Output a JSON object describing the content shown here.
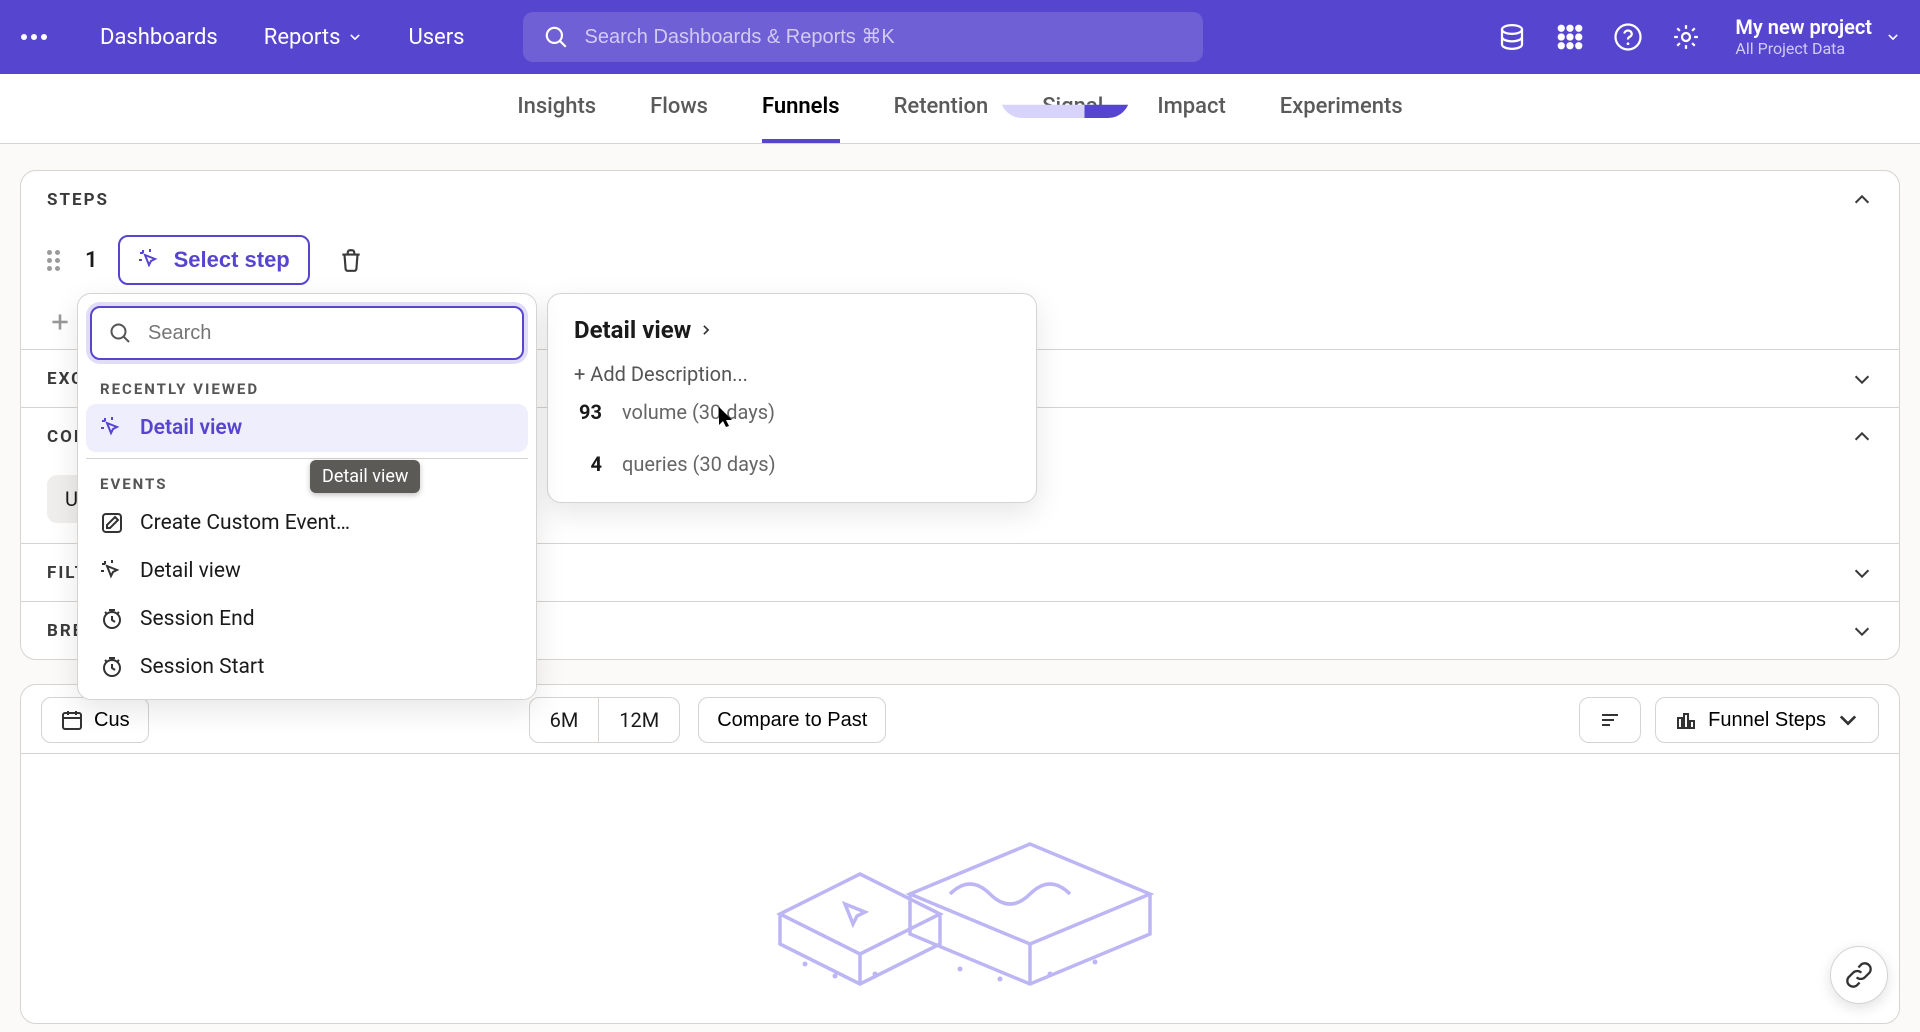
{
  "top": {
    "dashboards": "Dashboards",
    "reports": "Reports",
    "users": "Users",
    "search_ph": "Search Dashboards & Reports ⌘K",
    "project_name": "My new project",
    "project_sub": "All Project Data"
  },
  "subnav": {
    "insights": "Insights",
    "flows": "Flows",
    "funnels": "Funnels",
    "retention": "Retention",
    "signal": "Signal",
    "impact": "Impact",
    "experiments": "Experiments"
  },
  "steps": {
    "section": "STEPS",
    "step_num": "1",
    "select_step": "Select step"
  },
  "dropdown": {
    "search_ph": "Search",
    "recent_head": "RECENTLY VIEWED",
    "recent_1": "Detail view",
    "events_head": "EVENTS",
    "create_custom": "Create Custom Event…",
    "ev_detail": "Detail view",
    "ev_session_end": "Session End",
    "ev_session_start": "Session Start",
    "tooltip": "Detail view"
  },
  "detail": {
    "title": "Detail view",
    "add_desc": "+ Add Description...",
    "vol_num": "93",
    "vol_lbl": "volume (30 days)",
    "q_num": "4",
    "q_lbl": "queries (30 days)"
  },
  "sections": {
    "exclusion": "EXCLUSION",
    "conversion": "CONVERSION",
    "filters": "FILTERS",
    "breakdown": "BREAKDOWN"
  },
  "conv": {
    "uniques": "Uniques"
  },
  "toolbar": {
    "custom_prefix": "Cus",
    "m6": "6M",
    "m12": "12M",
    "compare": "Compare to Past",
    "funnel_steps": "Funnel Steps"
  }
}
